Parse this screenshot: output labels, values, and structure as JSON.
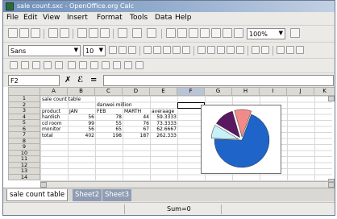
{
  "window": {
    "title": "sale count.sxc - OpenOffice.org Calc"
  },
  "menu": [
    "File",
    "Edit",
    "View",
    "Insert",
    "Format",
    "Tools",
    "Data",
    "Help"
  ],
  "toolbar": {
    "zoom": "100%",
    "font_name": "Sans",
    "font_size": "10"
  },
  "formula_bar": {
    "cell_reference": "F2",
    "formula": ""
  },
  "columns": [
    "A",
    "B",
    "C",
    "D",
    "E",
    "F",
    "G",
    "H",
    "I",
    "J",
    "K"
  ],
  "selected_column": "F",
  "rows": [
    "1",
    "2",
    "3",
    "4",
    "5",
    "6",
    "7",
    "8",
    "9",
    "10",
    "11",
    "12",
    "13",
    "14"
  ],
  "sheet": {
    "title": "sale count table",
    "unit": "danwei:million",
    "headers": [
      "product",
      "JAN",
      "FEB",
      "MARTH",
      "averaage"
    ],
    "data": [
      [
        "hardish",
        "56",
        "78",
        "44",
        "59.3333"
      ],
      [
        "cd room",
        "99",
        "55",
        "76",
        "73.3333"
      ],
      [
        "monitor",
        "56",
        "65",
        "67",
        "62.6667"
      ],
      [
        "total",
        "402",
        "198",
        "187",
        "262.333"
      ]
    ]
  },
  "chart": {
    "type": "pie",
    "slices": [
      {
        "color": "#1f64c8",
        "value": 0.7
      },
      {
        "color": "#c8f0f8",
        "value": 0.08
      },
      {
        "color": "#5a1860",
        "value": 0.12
      },
      {
        "color": "#f28a8a",
        "value": 0.1
      }
    ]
  },
  "tabs": [
    {
      "label": "sale count table",
      "active": true
    },
    {
      "label": "Sheet2",
      "active": false
    },
    {
      "label": "Sheet3",
      "active": false
    }
  ],
  "status": {
    "sum": "Sum=0"
  }
}
